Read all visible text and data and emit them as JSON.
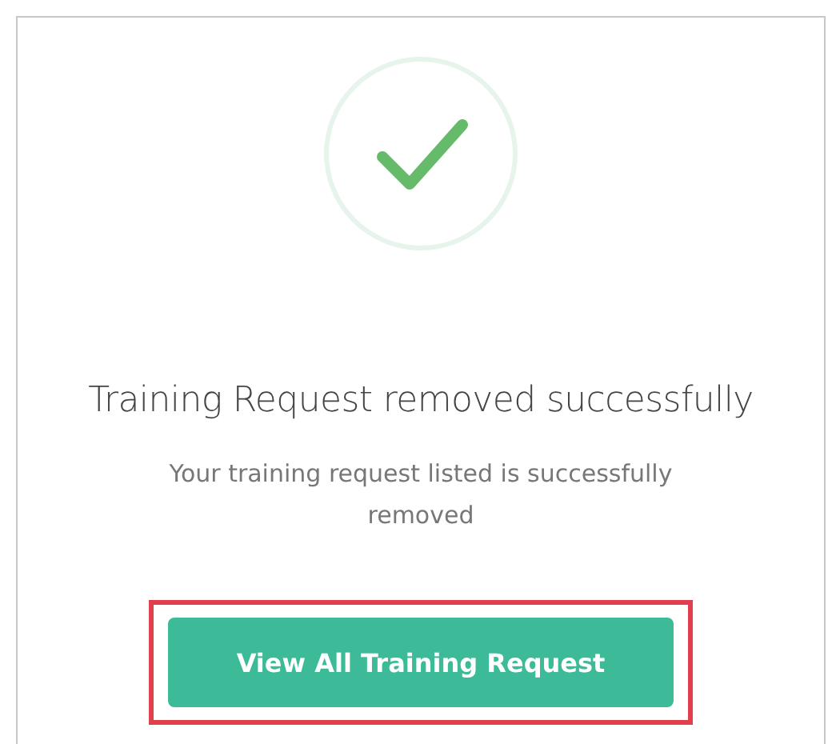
{
  "dialog": {
    "kind": "success",
    "title": "Training Request removed successfully",
    "message": "Your training request listed is successfully removed"
  },
  "button": {
    "label": "View All Training Request",
    "highlighted": true
  }
}
